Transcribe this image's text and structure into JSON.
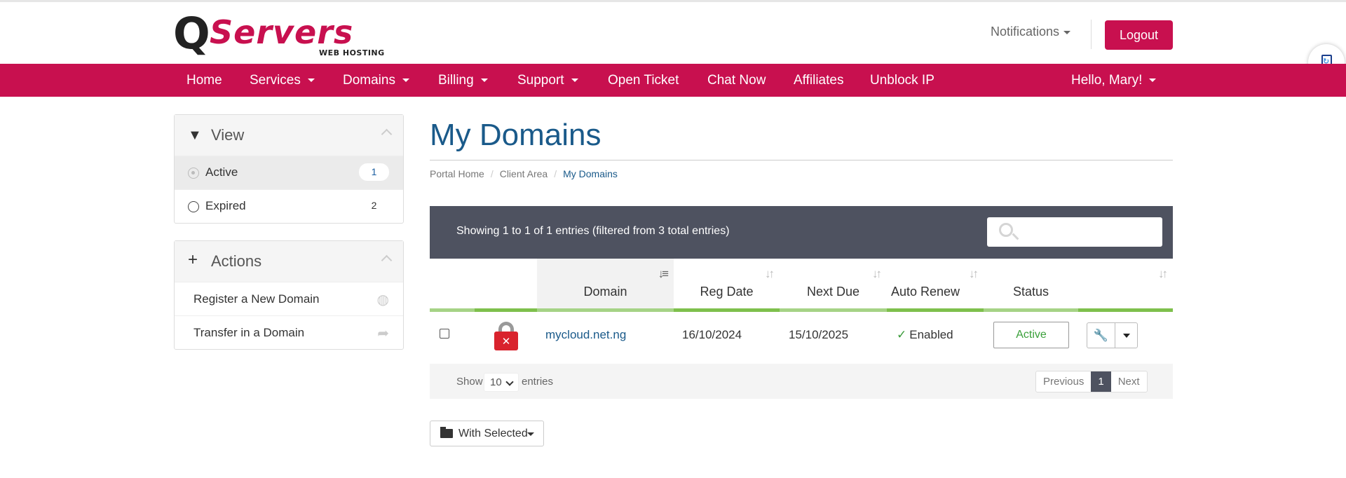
{
  "brand": {
    "logo_q": "Q",
    "logo_name": "Servers",
    "logo_sub": "WEB HOSTING"
  },
  "header": {
    "notifications": "Notifications",
    "logout": "Logout"
  },
  "nav": {
    "home": "Home",
    "services": "Services",
    "domains": "Domains",
    "billing": "Billing",
    "support": "Support",
    "open_ticket": "Open Ticket",
    "chat_now": "Chat Now",
    "affiliates": "Affiliates",
    "unblock_ip": "Unblock IP",
    "user": "Hello, Mary!"
  },
  "sidebar": {
    "view": {
      "title": "View",
      "filters": [
        {
          "label": "Active",
          "count": "1"
        },
        {
          "label": "Expired",
          "count": "2"
        }
      ]
    },
    "actions": {
      "title": "Actions",
      "items": [
        {
          "label": "Register a New Domain"
        },
        {
          "label": "Transfer in a Domain"
        }
      ]
    }
  },
  "page": {
    "title": "My Domains",
    "breadcrumb": [
      "Portal Home",
      "Client Area",
      "My Domains"
    ]
  },
  "table": {
    "info": "Showing 1 to 1 of 1 entries (filtered from 3 total entries)",
    "search_placeholder": "",
    "columns": [
      "Domain",
      "Reg Date",
      "Next Due",
      "Auto Renew",
      "Status"
    ],
    "rows": [
      {
        "domain": "mycloud.net.ng",
        "reg_date": "16/10/2024",
        "next_due": "15/10/2025",
        "auto_renew": "Enabled",
        "status": "Active",
        "lock_icon": "lock-error-icon"
      }
    ],
    "length": {
      "show": "Show",
      "value": "10",
      "entries": "entries"
    },
    "pagination": {
      "previous": "Previous",
      "current": "1",
      "next": "Next"
    }
  },
  "bulk": {
    "with_selected": "With Selected"
  },
  "colors": {
    "brand": "#c8104f",
    "table_header": "#4e5260",
    "accent_bar": "#7ec04c",
    "title": "#1a5a8a"
  }
}
